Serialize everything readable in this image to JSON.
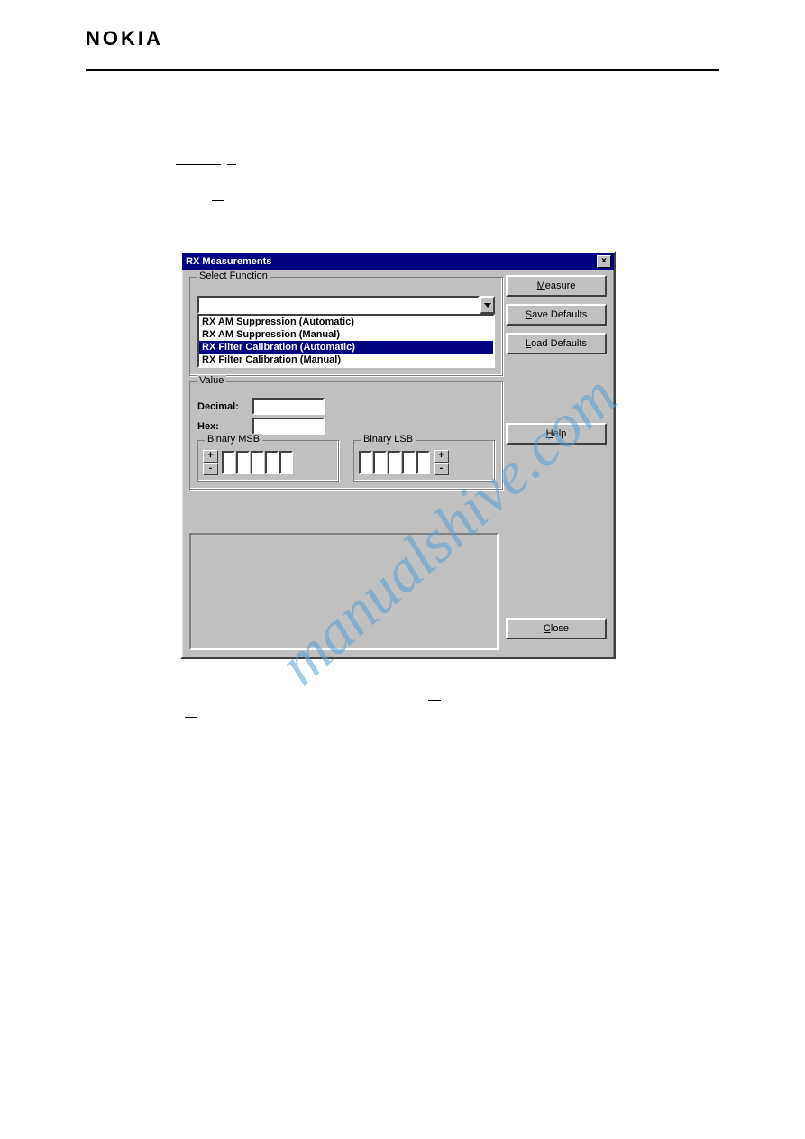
{
  "page": {
    "logo": "NOKIA"
  },
  "dialog": {
    "title": "RX Measurements",
    "select_function_label": "Select Function",
    "dropdown_items": [
      "RX AM Suppression (Automatic)",
      "RX AM Suppression (Manual)",
      "RX Filter Calibration (Automatic)",
      "RX Filter Calibration (Manual)"
    ],
    "selected_index": 2,
    "value_label": "Value",
    "decimal_label": "Decimal:",
    "hex_label": "Hex:",
    "binary_msb_label": "Binary MSB",
    "binary_lsb_label": "Binary LSB",
    "plus": "+",
    "minus": "-",
    "buttons": {
      "measure": "Measure",
      "measure_ul": "M",
      "save_defaults": "Save Defaults",
      "save_ul": "S",
      "load_defaults": "Load Defaults",
      "load_ul": "L",
      "help": "Help",
      "help_ul": "H",
      "close": "Close",
      "close_ul": "C"
    }
  },
  "watermark": "manualshive.com"
}
